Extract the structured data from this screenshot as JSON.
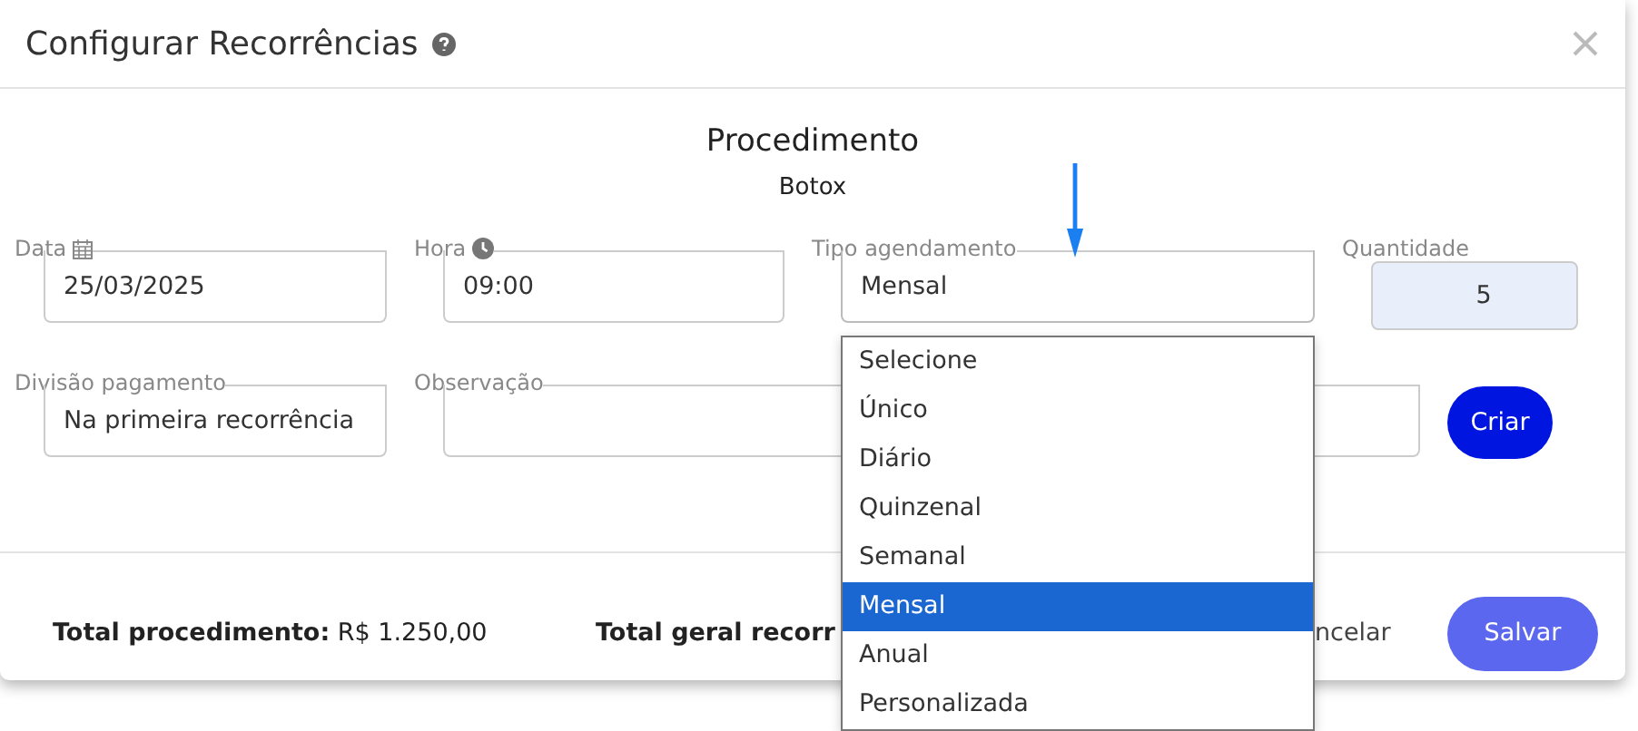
{
  "window": {
    "title": "Configurar Recorrências"
  },
  "procedure": {
    "heading": "Procedimento",
    "name": "Botox"
  },
  "fields": {
    "date": {
      "label": "Data",
      "value": "25/03/2025"
    },
    "time": {
      "label": "Hora",
      "value": "09:00"
    },
    "schedule_type": {
      "label": "Tipo agendamento",
      "value": "Mensal",
      "expanded": true,
      "options": [
        {
          "label": "Selecione",
          "selected": false
        },
        {
          "label": "Único",
          "selected": false
        },
        {
          "label": "Diário",
          "selected": false
        },
        {
          "label": "Quinzenal",
          "selected": false
        },
        {
          "label": "Semanal",
          "selected": false
        },
        {
          "label": "Mensal",
          "selected": true
        },
        {
          "label": "Anual",
          "selected": false
        },
        {
          "label": "Personalizada",
          "selected": false
        }
      ]
    },
    "quantity": {
      "label": "Quantidade",
      "value": "5"
    },
    "payment_split": {
      "label": "Divisão pagamento",
      "value": "Na primeira recorrência"
    },
    "note": {
      "label": "Observação"
    }
  },
  "create_button": "Criar",
  "footer": {
    "total_procedure": "**Total procedimento:** R$ 1.250,00",
    "total_general": "Total geral recorr",
    "cancel_button": "ncelar",
    "save_button": "Salvar"
  }
}
